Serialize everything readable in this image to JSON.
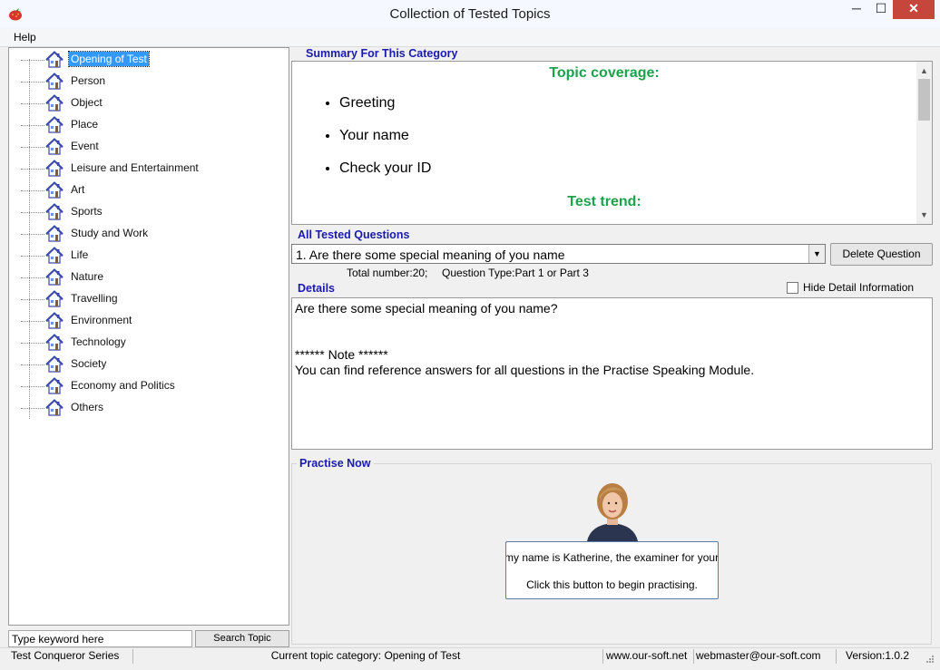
{
  "window": {
    "title": "Collection of Tested Topics",
    "min_glyph": "─",
    "max_glyph": "☐",
    "close_glyph": "✕"
  },
  "menu": {
    "help": "Help"
  },
  "tree": {
    "items": [
      {
        "label": "Opening of Test",
        "selected": true
      },
      {
        "label": "Person"
      },
      {
        "label": "Object"
      },
      {
        "label": "Place"
      },
      {
        "label": "Event"
      },
      {
        "label": "Leisure and Entertainment"
      },
      {
        "label": "Art"
      },
      {
        "label": "Sports"
      },
      {
        "label": "Study and Work"
      },
      {
        "label": "Life"
      },
      {
        "label": "Nature"
      },
      {
        "label": "Travelling"
      },
      {
        "label": "Environment"
      },
      {
        "label": "Technology"
      },
      {
        "label": "Society"
      },
      {
        "label": "Economy and Politics"
      },
      {
        "label": "Others"
      }
    ]
  },
  "search": {
    "value": "Type keyword here",
    "button": "Search Topic"
  },
  "summary": {
    "label": "Summary For This Category",
    "coverage_heading": "Topic coverage:",
    "coverage_items": [
      "Greeting",
      "Your name",
      "Check your ID"
    ],
    "trend_heading": "Test trend:"
  },
  "questions": {
    "label": "All Tested Questions",
    "selected": "1. Are there some special meaning of you name",
    "delete_button": "Delete Question",
    "total": "Total number:20;",
    "type": "Question Type:Part 1 or Part 3"
  },
  "details": {
    "label": "Details",
    "hide_label": "Hide Detail Information",
    "hide_checked": false,
    "question": "Are there some special meaning of you name?",
    "note_heading": "****** Note ******",
    "note_text": "You can find reference answers for all questions in the Practise Speaking Module."
  },
  "practise": {
    "label": "Practise Now",
    "intro": "my name is Katherine, the examiner for your",
    "button": "Click this button to begin practising."
  },
  "status": {
    "series": "Test Conqueror Series",
    "category": "Current topic category: Opening of Test",
    "website": "www.our-soft.net",
    "email": "webmaster@our-soft.com",
    "version": "Version:1.0.2"
  },
  "colors": {
    "heading_green": "#1aa34a",
    "label_blue": "#1a1ab0",
    "selection": "#3399ff",
    "close_red": "#c7463b"
  },
  "icons": {
    "app": "strawberry-icon",
    "tree_item": "house-icon",
    "combo": "dropdown-arrow-icon"
  }
}
